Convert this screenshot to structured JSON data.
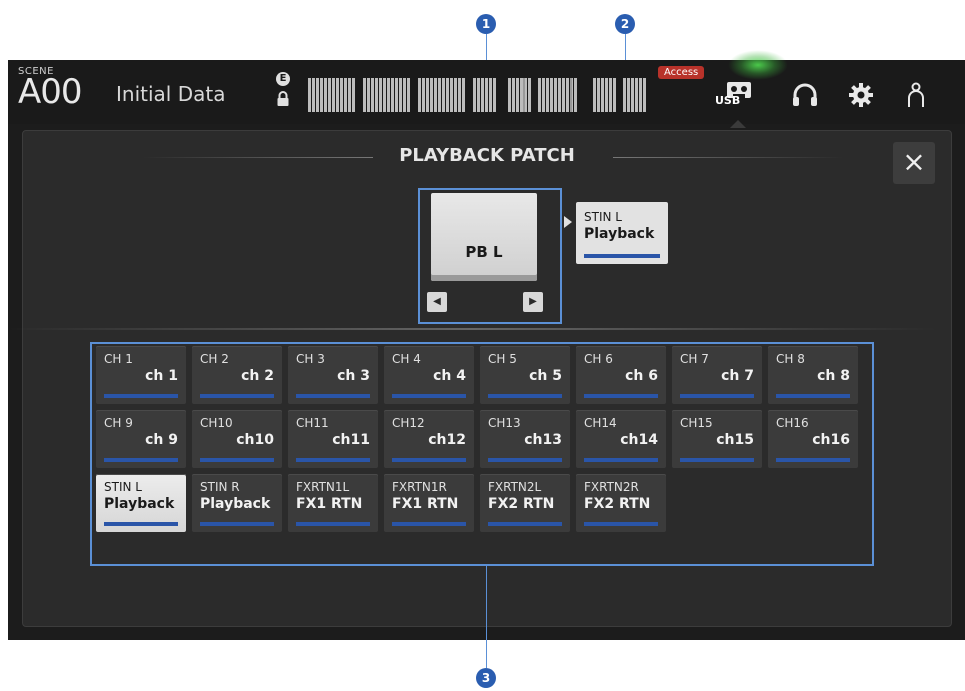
{
  "topbar": {
    "scene_label": "SCENE",
    "scene_number": "A00",
    "scene_title": "Initial Data",
    "access_badge": "Access",
    "usb_label": "USB"
  },
  "dialog": {
    "title": "PLAYBACK PATCH",
    "close_symbol": "×"
  },
  "source": {
    "label": "PB L",
    "prev_symbol": "◀",
    "next_symbol": "▶"
  },
  "destination": {
    "channel": "STIN L",
    "name": "Playback"
  },
  "channels": [
    {
      "channel": "CH 1",
      "name": "ch 1"
    },
    {
      "channel": "CH 2",
      "name": "ch 2"
    },
    {
      "channel": "CH 3",
      "name": "ch 3"
    },
    {
      "channel": "CH 4",
      "name": "ch 4"
    },
    {
      "channel": "CH 5",
      "name": "ch 5"
    },
    {
      "channel": "CH 6",
      "name": "ch 6"
    },
    {
      "channel": "CH 7",
      "name": "ch 7"
    },
    {
      "channel": "CH 8",
      "name": "ch 8"
    },
    {
      "channel": "CH 9",
      "name": "ch 9"
    },
    {
      "channel": "CH10",
      "name": "ch10"
    },
    {
      "channel": "CH11",
      "name": "ch11"
    },
    {
      "channel": "CH12",
      "name": "ch12"
    },
    {
      "channel": "CH13",
      "name": "ch13"
    },
    {
      "channel": "CH14",
      "name": "ch14"
    },
    {
      "channel": "CH15",
      "name": "ch15"
    },
    {
      "channel": "CH16",
      "name": "ch16"
    },
    {
      "channel": "STIN L",
      "name": "Playback",
      "selected": true
    },
    {
      "channel": "STIN R",
      "name": "Playback"
    },
    {
      "channel": "FXRTN1L",
      "name": "FX1 RTN"
    },
    {
      "channel": "FXRTN1R",
      "name": "FX1 RTN"
    },
    {
      "channel": "FXRTN2L",
      "name": "FX2 RTN"
    },
    {
      "channel": "FXRTN2R",
      "name": "FX2 RTN"
    }
  ],
  "callouts": [
    "1",
    "2",
    "3"
  ],
  "colors": {
    "accent_blue": "#2a55a8",
    "callout_blue": "#2a5db0",
    "access_red": "#b8322a",
    "usb_glow": "#50dc50"
  },
  "icons": {
    "edit": "e-icon",
    "lock": "lock-icon",
    "usb": "usb-recorder-icon",
    "headphones": "headphones-icon",
    "settings": "gear-icon",
    "user": "user-icon"
  }
}
